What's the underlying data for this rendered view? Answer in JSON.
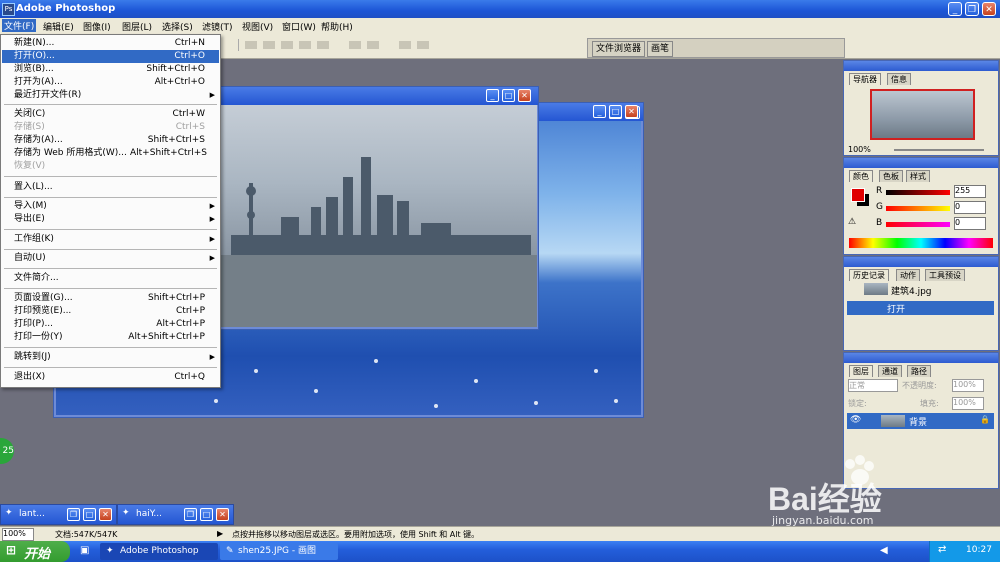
{
  "app": {
    "title": "Adobe Photoshop",
    "icon": "photoshop-icon"
  },
  "window_controls": {
    "minimize": "_",
    "maximize": "❐",
    "close": "✕"
  },
  "menubar": [
    "文件(F)",
    "编辑(E)",
    "图像(I)",
    "图层(L)",
    "选择(S)",
    "滤镜(T)",
    "视图(V)",
    "窗口(W)",
    "帮助(H)"
  ],
  "palette_well": [
    "文件浏览器",
    "画笔"
  ],
  "file_menu": [
    {
      "label": "新建(N)...",
      "shortcut": "Ctrl+N"
    },
    {
      "label": "打开(O)...",
      "shortcut": "Ctrl+O",
      "highlighted": true
    },
    {
      "label": "浏览(B)...",
      "shortcut": "Shift+Ctrl+O"
    },
    {
      "label": "打开为(A)...",
      "shortcut": "Alt+Ctrl+O"
    },
    {
      "label": "最近打开文件(R)",
      "shortcut": "",
      "submenu": true
    },
    {
      "label": "关闭(C)",
      "shortcut": "Ctrl+W"
    },
    {
      "label": "存储(S)",
      "shortcut": "Ctrl+S",
      "disabled": true
    },
    {
      "label": "存储为(A)...",
      "shortcut": "Shift+Ctrl+S"
    },
    {
      "label": "存储为 Web 所用格式(W)...",
      "shortcut": "Alt+Shift+Ctrl+S"
    },
    {
      "label": "恢复(V)",
      "shortcut": "",
      "disabled": true
    },
    {
      "label": "置入(L)...",
      "shortcut": ""
    },
    {
      "label": "导入(M)",
      "shortcut": "",
      "submenu": true
    },
    {
      "label": "导出(E)",
      "shortcut": "",
      "submenu": true
    },
    {
      "label": "工作组(K)",
      "shortcut": "",
      "submenu": true
    },
    {
      "label": "自动(U)",
      "shortcut": "",
      "submenu": true
    },
    {
      "label": "文件简介...",
      "shortcut": ""
    },
    {
      "label": "页面设置(G)...",
      "shortcut": "Shift+Ctrl+P"
    },
    {
      "label": "打印预览(E)...",
      "shortcut": "Ctrl+P"
    },
    {
      "label": "打印(P)...",
      "shortcut": "Alt+Ctrl+P"
    },
    {
      "label": "打印一份(Y)",
      "shortcut": "Alt+Shift+Ctrl+P"
    },
    {
      "label": "跳转到(J)",
      "shortcut": "",
      "submenu": true
    },
    {
      "label": "退出(X)",
      "shortcut": "Ctrl+Q"
    }
  ],
  "navigator": {
    "tabs": [
      "导航器",
      "信息"
    ],
    "zoom": "100%"
  },
  "color": {
    "tabs": [
      "颜色",
      "色板",
      "样式"
    ],
    "r_label": "R",
    "g_label": "G",
    "b_label": "B",
    "r": "255",
    "g": "0",
    "b": "0",
    "foreground": "#e00000",
    "background": "#000000"
  },
  "history": {
    "tabs": [
      "历史记录",
      "动作",
      "工具预设"
    ],
    "snapshot": "建筑4.jpg",
    "step": "打开"
  },
  "layers": {
    "tabs": [
      "图层",
      "通道",
      "路径"
    ],
    "mode": "正常",
    "opacity_label": "不透明度:",
    "opacity": "100%",
    "lock_label": "锁定:",
    "fill_label": "填充:",
    "fill": "100%",
    "layer_name": "背景"
  },
  "minimized": [
    {
      "title": "lant..."
    },
    {
      "title": "haiY..."
    }
  ],
  "status": {
    "zoom": "100%",
    "doc": "文档:547K/547K",
    "hint": "点按并拖移以移动图层或选区。要用附加选项，使用 Shift 和 Alt 键。"
  },
  "taskbar": {
    "start": "开始",
    "tasks": [
      "Adobe Photoshop",
      "shen25.JPG - 画图"
    ],
    "clock": "10:27"
  },
  "badge": "25",
  "watermark": {
    "text": "Bai经验",
    "url": "jingyan.baidu.com"
  }
}
